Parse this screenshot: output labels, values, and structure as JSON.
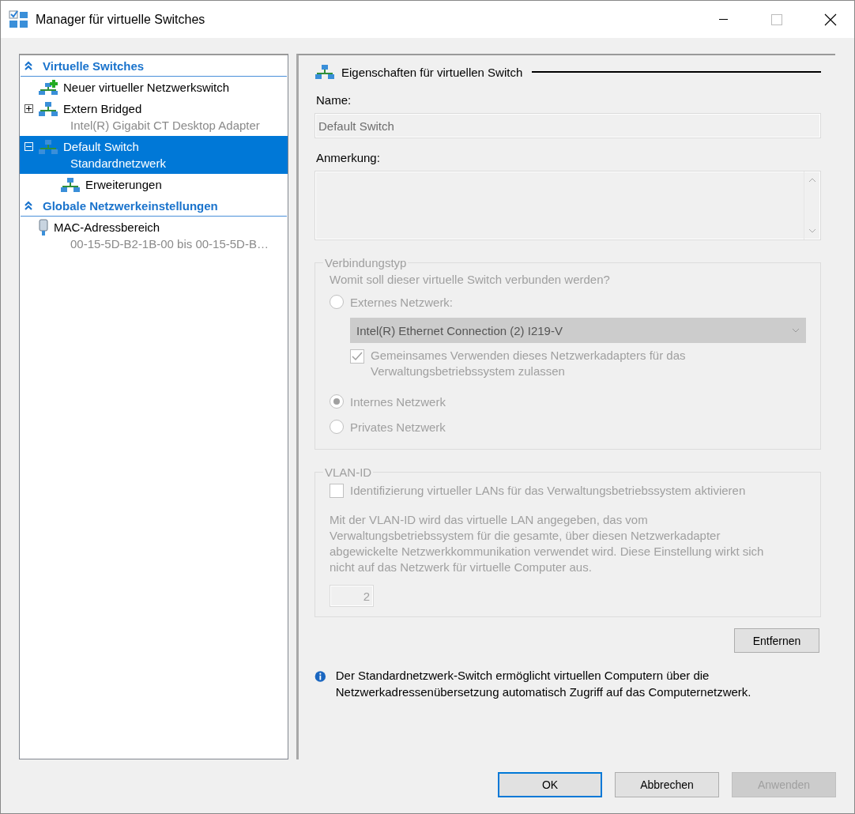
{
  "window": {
    "title": "Manager für virtuelle Switches"
  },
  "sidebar": {
    "sections": [
      {
        "title": "Virtuelle Switches",
        "expanded": true,
        "items": [
          {
            "kind": "new",
            "label": "Neuer virtueller Netzwerkswitch",
            "selected": false
          },
          {
            "kind": "switch",
            "label": "Extern Bridged",
            "sublabel": "Intel(R) Gigabit CT Desktop Adapter",
            "expanded": false,
            "selected": false
          },
          {
            "kind": "switch",
            "label": "Default Switch",
            "sublabel": "Standardnetzwerk",
            "expanded": true,
            "selected": true,
            "children": [
              {
                "kind": "extension",
                "label": "Erweiterungen",
                "selected": false
              }
            ]
          }
        ]
      },
      {
        "title": "Globale Netzwerkeinstellungen",
        "expanded": true,
        "items": [
          {
            "kind": "mac",
            "label": "MAC-Adressbereich",
            "sublabel": "00-15-5D-B2-1B-00 bis 00-15-5D-B…",
            "selected": false
          }
        ]
      }
    ]
  },
  "properties": {
    "heading": "Eigenschaften für virtuellen Switch",
    "name_label": "Name:",
    "name_value": "Default Switch",
    "note_label": "Anmerkung:",
    "connection_type": {
      "legend": "Verbindungstyp",
      "disabled": true,
      "question": "Womit soll dieser virtuelle Switch verbunden werden?",
      "options": [
        {
          "kind": "radio",
          "label": "Externes Netzwerk:",
          "selected": false
        },
        {
          "kind": "dropdown",
          "value": "Intel(R) Ethernet Connection (2) I219-V"
        },
        {
          "kind": "checkbox",
          "label": "Gemeinsames Verwenden dieses Netzwerkadapters für das Verwaltungsbetriebssystem zulassen",
          "checked": true
        },
        {
          "kind": "radio",
          "label": "Internes Netzwerk",
          "selected": true
        },
        {
          "kind": "radio",
          "label": "Privates Netzwerk",
          "selected": false
        }
      ]
    },
    "vlan": {
      "legend": "VLAN-ID",
      "disabled": true,
      "checkbox": {
        "label": "Identifizierung virtueller LANs für das Verwaltungsbetriebssystem aktivieren",
        "checked": false
      },
      "description": "Mit der VLAN-ID wird das virtuelle LAN angegeben, das vom Verwaltungsbetriebssystem für die gesamte, über diesen Netzwerkadapter abgewickelte Netzwerkkommunikation verwendet wird. Diese Einstellung wirkt sich nicht auf das Netzwerk für virtuelle Computer aus.",
      "value": "2"
    },
    "remove_button": "Entfernen",
    "info": "Der Standardnetzwerk-Switch ermöglicht virtuellen Computern über die Netzwerkadressenübersetzung automatisch Zugriff auf das Computernetzwerk."
  },
  "buttons": [
    {
      "label": "OK",
      "default": true,
      "disabled": false
    },
    {
      "label": "Abbrechen",
      "default": false,
      "disabled": false
    },
    {
      "label": "Anwenden",
      "default": false,
      "disabled": true
    }
  ]
}
